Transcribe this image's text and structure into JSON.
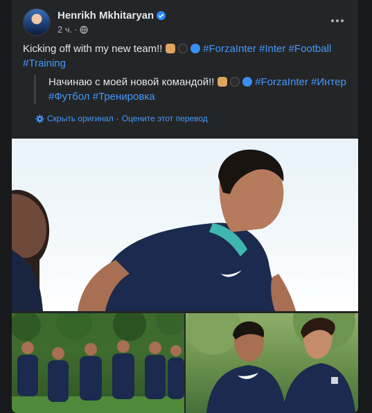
{
  "post": {
    "author": "Henrikh Mkhitaryan",
    "time": "2 ч.",
    "text_prefix": "Kicking off with my new team!!",
    "hashtags": [
      "#ForzaInter",
      "#Inter",
      "#Football",
      "#Training"
    ],
    "translation_prefix": "Начинаю с моей новой командой!!",
    "translation_hashtags": [
      "#ForzaInter",
      "#Интер",
      "#Футбол",
      "#Тренировка"
    ],
    "hide_original": "Скрыть оригинал",
    "separator": "·",
    "rate_translation": "Оцените этот перевод"
  },
  "icons": [
    "verified-badge-icon",
    "globe-icon",
    "more-options-icon",
    "gear-icon",
    "fist-emoji",
    "black-circle-emoji",
    "blue-circle-emoji"
  ],
  "colors": {
    "background": "#18191a",
    "card": "#242526",
    "link": "#4599ff",
    "secondary_text": "#b0b3b8"
  }
}
